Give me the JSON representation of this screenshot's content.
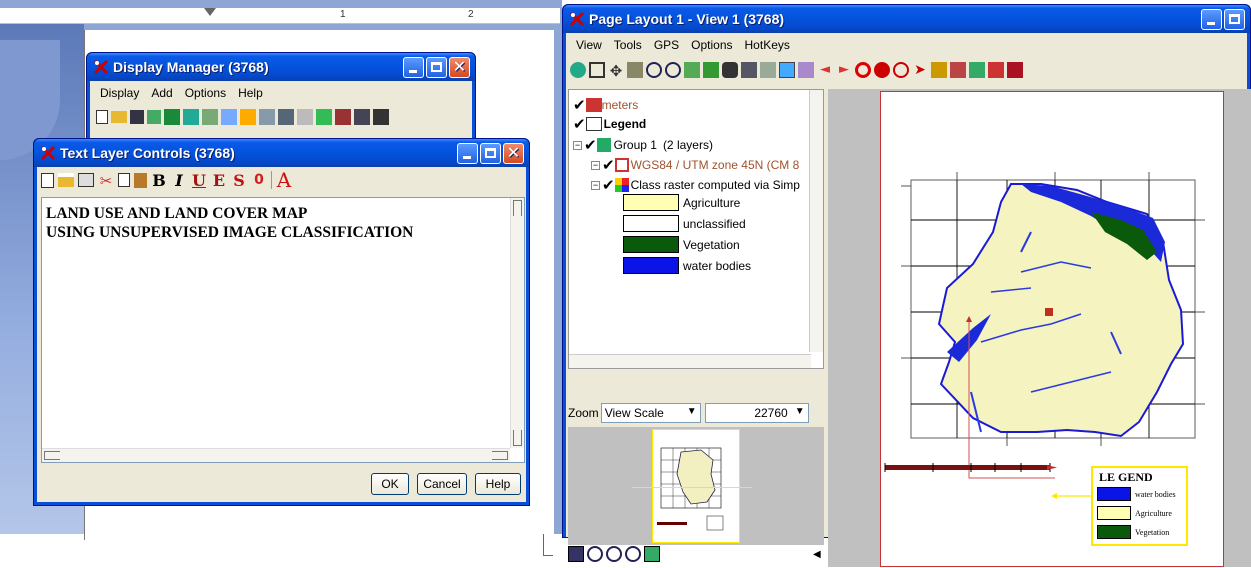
{
  "display_manager": {
    "title": "Display Manager (3768)",
    "menu": [
      "Display",
      "Add",
      "Options",
      "Help"
    ]
  },
  "text_layer_controls": {
    "title": "Text Layer Controls (3768)",
    "toolbar_letters": {
      "bold": "B",
      "italic": "I",
      "underline": "U",
      "emphasis": "E",
      "outline": "S",
      "zero": "0",
      "font": "A"
    },
    "text_line1": "LAND USE AND LAND COVER MAP",
    "text_line2": "USING UNSUPERVISED IMAGE CLASSIFICATION",
    "ok_label": "OK",
    "cancel_label": "Cancel",
    "help_label": "Help"
  },
  "ruler": {
    "marks": [
      "1",
      "2"
    ]
  },
  "page_layout": {
    "title": "Page Layout 1 - View 1 (3768)",
    "menu": [
      "View",
      "Tools",
      "GPS",
      "Options",
      "HotKeys"
    ],
    "tree": {
      "meters": "meters",
      "legend": "Legend",
      "group": "Group 1",
      "group_count": "(2 layers)",
      "wgs_layer": "WGS84 / UTM zone 45N (CM 8",
      "class_layer": "Class raster computed via Simp",
      "classes": [
        {
          "label": "Agriculture",
          "color": "#ffffb4"
        },
        {
          "label": "unclassified",
          "color": "#ffffff"
        },
        {
          "label": "Vegetation",
          "color": "#0b5a0b"
        },
        {
          "label": "water bodies",
          "color": "#0a14e6"
        }
      ]
    },
    "zoom": {
      "label": "Zoom",
      "mode": "View Scale",
      "value": "22760"
    },
    "map_legend": {
      "title": "LE GEND",
      "items": [
        {
          "label": "water bodies",
          "color": "#0a14e6"
        },
        {
          "label": "Agriculture",
          "color": "#ffffb4"
        },
        {
          "label": "Vegetation",
          "color": "#0b5a0b"
        }
      ]
    }
  },
  "colors": {
    "xp_blue": "#0453dd",
    "face": "#ece9d8",
    "accent_red": "#c83232",
    "yellow": "#ffe800"
  }
}
